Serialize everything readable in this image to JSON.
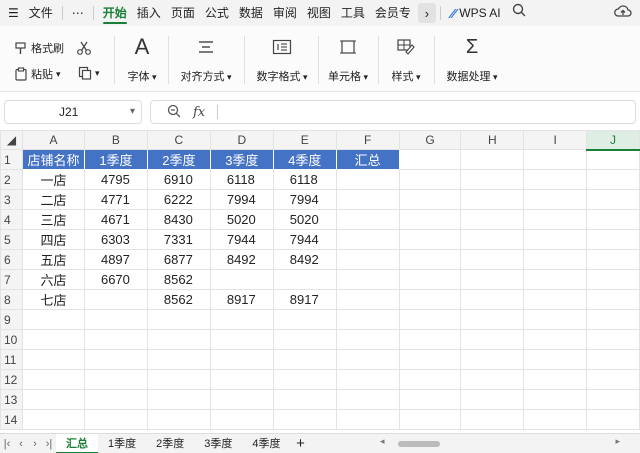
{
  "menubar": {
    "file": "文件",
    "more": "⋯",
    "tabs": [
      "开始",
      "插入",
      "页面",
      "公式",
      "数据",
      "审阅",
      "视图",
      "工具",
      "会员专"
    ],
    "active_tab": "开始",
    "wps_ai": "WPS AI"
  },
  "ribbon": {
    "format_painter": "格式刷",
    "paste": "粘贴",
    "font": "字体",
    "align": "对齐方式",
    "number_format": "数字格式",
    "cell": "单元格",
    "style": "样式",
    "data_process": "数据处理"
  },
  "formula_bar": {
    "cell_ref": "J21",
    "fx": "fx",
    "value": ""
  },
  "grid": {
    "columns": [
      "A",
      "B",
      "C",
      "D",
      "E",
      "F",
      "G",
      "H",
      "I",
      "J"
    ],
    "selected_column": "J",
    "row_numbers": [
      "1",
      "2",
      "3",
      "4",
      "5",
      "6",
      "7",
      "8",
      "9",
      "10",
      "11",
      "12",
      "13",
      "14"
    ],
    "header_row": [
      "店铺名称",
      "1季度",
      "2季度",
      "3季度",
      "4季度",
      "汇总"
    ],
    "rows": [
      [
        "一店",
        "4795",
        "6910",
        "6118",
        "6118",
        ""
      ],
      [
        "二店",
        "4771",
        "6222",
        "7994",
        "7994",
        ""
      ],
      [
        "三店",
        "4671",
        "8430",
        "5020",
        "5020",
        ""
      ],
      [
        "四店",
        "6303",
        "7331",
        "7944",
        "7944",
        ""
      ],
      [
        "五店",
        "4897",
        "6877",
        "8492",
        "8492",
        ""
      ],
      [
        "六店",
        "6670",
        "8562",
        "",
        "",
        ""
      ],
      [
        "七店",
        "",
        "8562",
        "8917",
        "8917",
        ""
      ]
    ],
    "header_color": "#4472c4"
  },
  "sheets": {
    "tabs": [
      "汇总",
      "1季度",
      "2季度",
      "3季度",
      "4季度"
    ],
    "active": "汇总",
    "add": "+"
  },
  "icons": [
    "format-painter-icon",
    "cut-icon",
    "paste-icon",
    "copy-icon",
    "font-icon",
    "align-icon",
    "number-format-icon",
    "cell-icon",
    "style-icon",
    "sum-icon",
    "search-icon",
    "cloud-icon",
    "zoom-icon"
  ]
}
